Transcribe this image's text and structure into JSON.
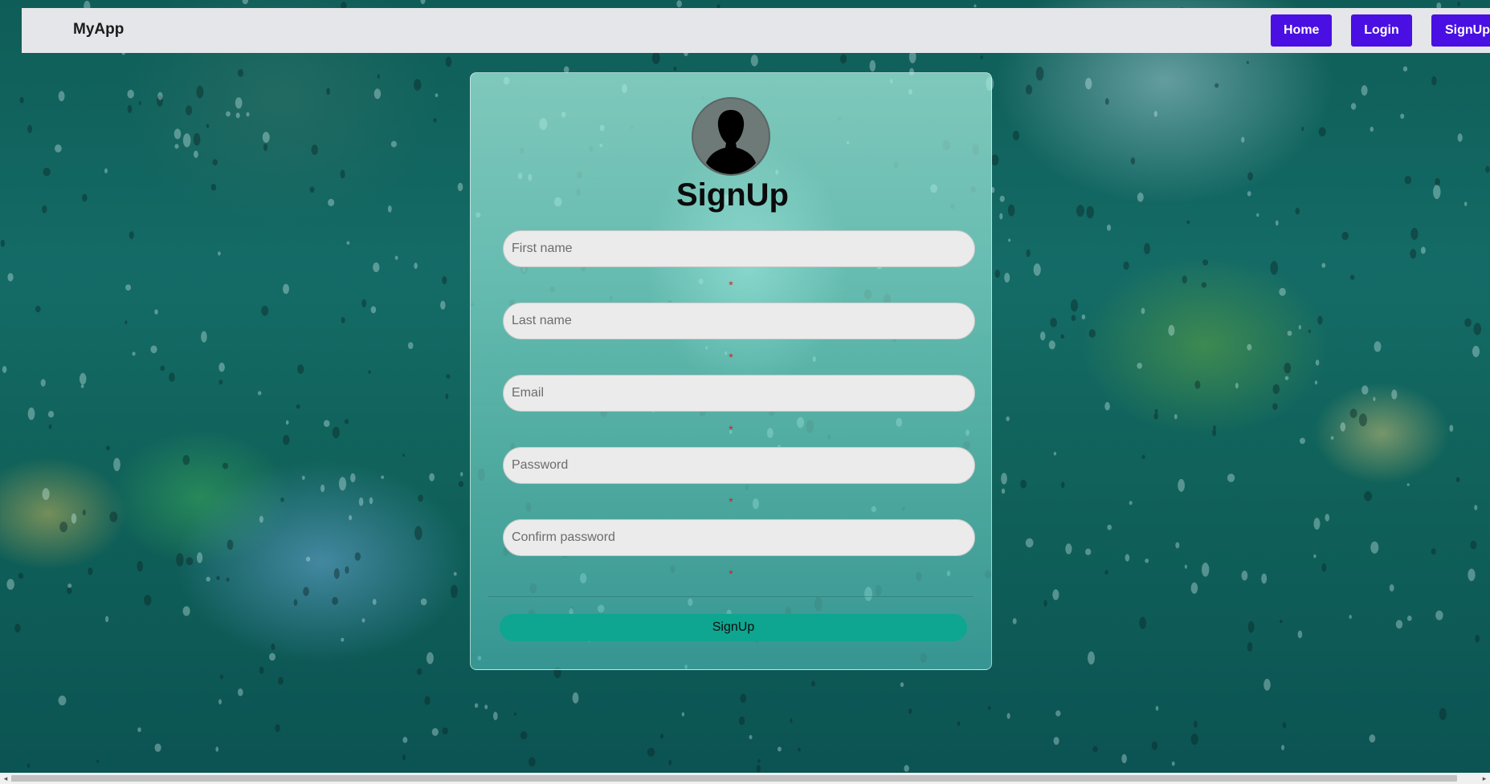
{
  "navbar": {
    "brand": "MyApp",
    "links": [
      {
        "label": "Home"
      },
      {
        "label": "Login"
      },
      {
        "label": "SignUp"
      }
    ],
    "button_color": "#4a0fe3"
  },
  "form": {
    "title": "SignUp",
    "avatar_icon": "user-silhouette-icon",
    "fields": [
      {
        "placeholder": "First name",
        "value": "",
        "required_marker": "*"
      },
      {
        "placeholder": "Last name",
        "value": "",
        "required_marker": "*"
      },
      {
        "placeholder": "Email",
        "value": "",
        "required_marker": "*"
      },
      {
        "placeholder": "Password",
        "value": "",
        "required_marker": "*"
      },
      {
        "placeholder": "Confirm password",
        "value": "",
        "required_marker": "*"
      }
    ],
    "submit_label": "SignUp",
    "submit_color": "#0ea690"
  },
  "scrollbar": {
    "left_arrow": "◂",
    "right_arrow": "▸"
  }
}
